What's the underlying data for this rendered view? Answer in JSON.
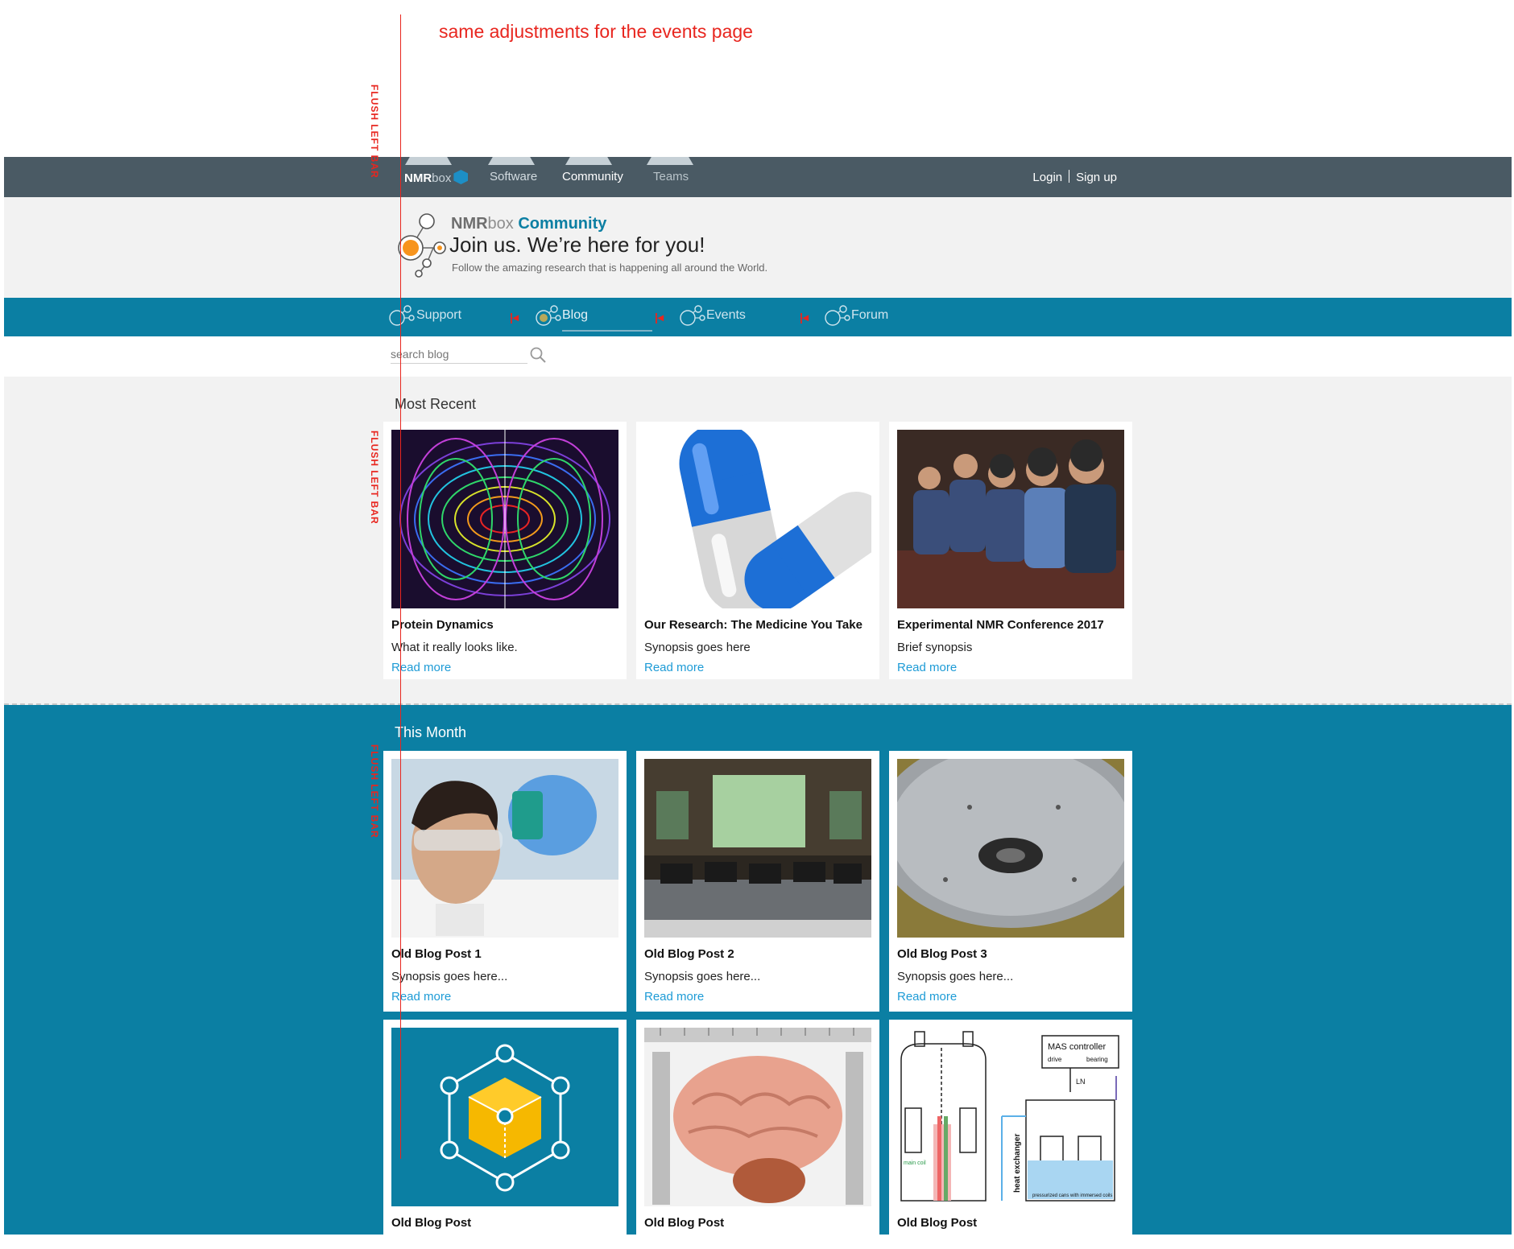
{
  "annotations": {
    "page_note": "same adjustments for the events page",
    "flush_label": "FLUSH LEFT BAR"
  },
  "colors": {
    "topbar": "#4a5a64",
    "accent_teal": "#0b7fa3",
    "link_blue": "#1d9bd6",
    "annotation_red": "#e8261f",
    "hero_bg": "#f2f2f2"
  },
  "topnav": {
    "logo_bold": "NMR",
    "logo_light": "box",
    "items": [
      "Software",
      "Community",
      "Teams"
    ],
    "active": "Community",
    "login": "Login",
    "signup": "Sign up"
  },
  "hero": {
    "brand_bold": "NMR",
    "brand_light": "box",
    "brand_accent": "Community",
    "title": "Join us. We’re here for you!",
    "subtitle": "Follow the amazing research that is happening all around the World."
  },
  "subnav": {
    "items": [
      "Support",
      "Blog",
      "Events",
      "Forum"
    ],
    "active": "Blog"
  },
  "search": {
    "placeholder": "search blog"
  },
  "most_recent": {
    "heading": "Most Recent",
    "cards": [
      {
        "title": "Protein Dynamics",
        "synopsis": "What it really looks like.",
        "link": "Read more"
      },
      {
        "title": "Our Research: The Medicine You Take",
        "synopsis": "Synopsis goes here",
        "link": "Read more"
      },
      {
        "title": "Experimental NMR Conference 2017",
        "synopsis": "Brief synopsis",
        "link": "Read more"
      }
    ]
  },
  "this_month": {
    "heading": "This Month",
    "cards": [
      {
        "title": "Old Blog Post 1",
        "synopsis": "Synopsis goes here...",
        "link": "Read more"
      },
      {
        "title": "Old Blog Post 2",
        "synopsis": "Synopsis goes here...",
        "link": "Read more"
      },
      {
        "title": "Old Blog Post 3",
        "synopsis": "Synopsis goes here...",
        "link": "Read more"
      },
      {
        "title": "Old Blog Post"
      },
      {
        "title": "Old Blog Post"
      },
      {
        "title": "Old Blog Post"
      }
    ]
  },
  "diagram_labels": {
    "controller": "MAS controller",
    "drive": "drive",
    "bearing": "bearing",
    "ln2": "LN",
    "heat_exchanger": "heat exchanger",
    "cans": "pressurized cans with immersed coils",
    "main_coil": "main coil"
  }
}
